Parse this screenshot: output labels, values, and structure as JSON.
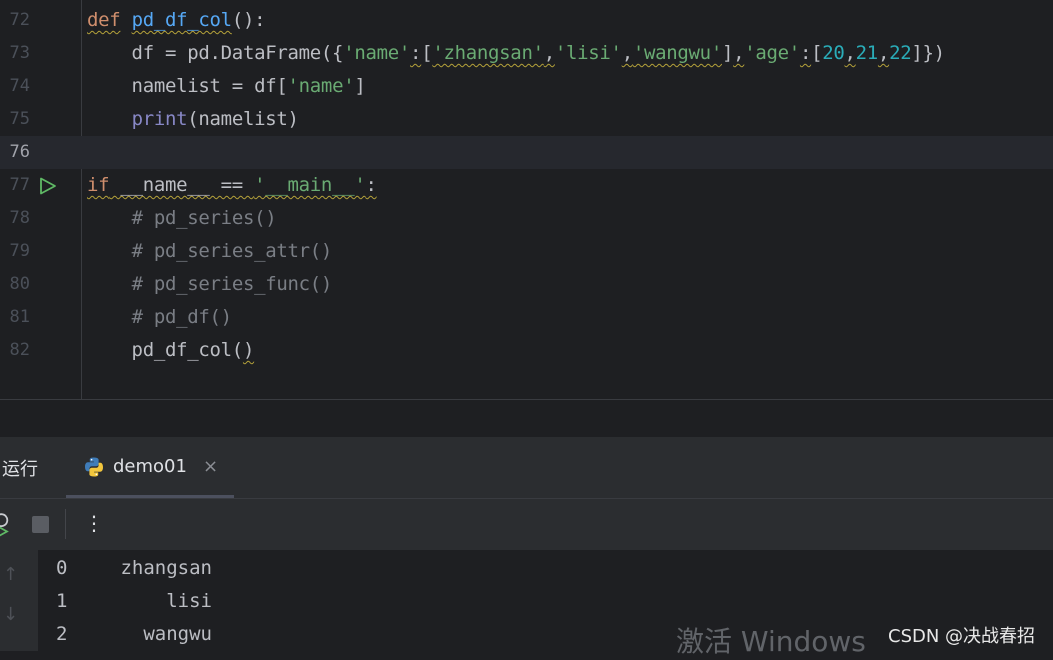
{
  "editor": {
    "lines": [
      {
        "num": "72",
        "tokens": [
          {
            "t": "def",
            "c": "kw",
            "sq": true
          },
          {
            "t": " "
          },
          {
            "t": "pd_df_col",
            "c": "fn",
            "sq": true
          },
          {
            "t": "():"
          }
        ]
      },
      {
        "num": "73",
        "tokens": [
          {
            "t": "    df = pd.DataFrame({"
          },
          {
            "t": "'name'",
            "c": "str"
          },
          {
            "t": ":",
            "sq": true
          },
          {
            "t": "["
          },
          {
            "t": "'zhangsan'",
            "c": "str",
            "sq": true
          },
          {
            "t": ",",
            "sq": true
          },
          {
            "t": "'lisi'",
            "c": "str"
          },
          {
            "t": ",",
            "sq": true
          },
          {
            "t": "'wangwu'",
            "c": "str",
            "sq": true
          },
          {
            "t": "]"
          },
          {
            "t": ",",
            "sq": true
          },
          {
            "t": "'age'",
            "c": "str"
          },
          {
            "t": ":",
            "sq": true
          },
          {
            "t": "["
          },
          {
            "t": "20",
            "c": "num"
          },
          {
            "t": ",",
            "sq": true
          },
          {
            "t": "21",
            "c": "num"
          },
          {
            "t": ",",
            "sq": true
          },
          {
            "t": "22",
            "c": "num"
          },
          {
            "t": "]})"
          }
        ]
      },
      {
        "num": "74",
        "tokens": [
          {
            "t": "    namelist = df["
          },
          {
            "t": "'name'",
            "c": "str"
          },
          {
            "t": "]"
          }
        ]
      },
      {
        "num": "75",
        "tokens": [
          {
            "t": "    "
          },
          {
            "t": "print",
            "c": "bi"
          },
          {
            "t": "(namelist)"
          }
        ]
      },
      {
        "num": "76",
        "current": true,
        "tokens": []
      },
      {
        "num": "77",
        "run": true,
        "tokens": [
          {
            "t": "if",
            "c": "kw",
            "sq": true
          },
          {
            "t": " __name__ == ",
            "sq": true
          },
          {
            "t": "'__main__'",
            "c": "str",
            "sq": true
          },
          {
            "t": ":",
            "sq": true
          }
        ]
      },
      {
        "num": "78",
        "tokens": [
          {
            "t": "    "
          },
          {
            "t": "# pd_series()",
            "c": "cmt"
          }
        ]
      },
      {
        "num": "79",
        "tokens": [
          {
            "t": "    "
          },
          {
            "t": "# pd_series_attr()",
            "c": "cmt"
          }
        ]
      },
      {
        "num": "80",
        "tokens": [
          {
            "t": "    "
          },
          {
            "t": "# pd_series_func()",
            "c": "cmt"
          }
        ]
      },
      {
        "num": "81",
        "tokens": [
          {
            "t": "    "
          },
          {
            "t": "# pd_df()",
            "c": "cmt"
          }
        ]
      },
      {
        "num": "82",
        "tokens": [
          {
            "t": "    pd_df_col("
          },
          {
            "t": ")",
            "sq": true
          }
        ]
      }
    ]
  },
  "run_panel": {
    "title": "运行",
    "tab": {
      "label": "demo01",
      "close": "×",
      "icon": "python-icon"
    },
    "toolbar": {
      "more": "⋮"
    },
    "output": [
      {
        "idx": "0",
        "val": "zhangsan"
      },
      {
        "idx": "1",
        "val": "lisi"
      },
      {
        "idx": "2",
        "val": "wangwu"
      }
    ]
  },
  "overlay": {
    "watermark": "激活 Windows",
    "csdn": "CSDN @决战春招"
  },
  "colors": {
    "background": "#1e1f22",
    "keyword": "#cf8e6d",
    "function": "#56a8f5",
    "string": "#6aab73",
    "number": "#2aacb8",
    "comment": "#7a7e85",
    "run_green": "#5fb865"
  }
}
